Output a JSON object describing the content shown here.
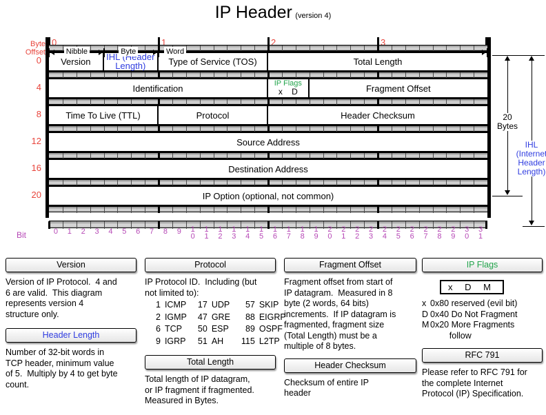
{
  "title": {
    "main": "IP Header",
    "sub": "(version 4)"
  },
  "diagram": {
    "byte_offset_label_line1": "Byte",
    "byte_offset_label_line2": "Offset",
    "bit_label": "Bit",
    "byte_offsets": [
      "0",
      "4",
      "8",
      "12",
      "16",
      "20"
    ],
    "top_ruler_numbers": [
      "0",
      "1",
      "2",
      "3"
    ],
    "bit_numbers": [
      "0",
      "1",
      "2",
      "3",
      "4",
      "5",
      "6",
      "7",
      "8",
      "9",
      "10",
      "11",
      "12",
      "13",
      "14",
      "15",
      "16",
      "17",
      "18",
      "19",
      "20",
      "21",
      "22",
      "23",
      "24",
      "25",
      "26",
      "27",
      "28",
      "29",
      "30",
      "31"
    ],
    "spans": [
      "Nibble",
      "Byte",
      "Word"
    ],
    "rows": [
      {
        "offset": "0",
        "cells": [
          {
            "label": "Version",
            "bits": 4
          },
          {
            "label": "IHL (Header Length)",
            "bits": 4,
            "color": "blue"
          },
          {
            "label": "Type of Service (TOS)",
            "bits": 8
          },
          {
            "label": "Total Length",
            "bits": 16
          }
        ]
      },
      {
        "offset": "4",
        "cells": [
          {
            "label": "Identification",
            "bits": 16
          },
          {
            "label": "IP Flags",
            "sublabel": "x  D  M",
            "bits": 3,
            "color": "green"
          },
          {
            "label": "Fragment Offset",
            "bits": 13
          }
        ]
      },
      {
        "offset": "8",
        "cells": [
          {
            "label": "Time To Live (TTL)",
            "bits": 8
          },
          {
            "label": "Protocol",
            "bits": 8
          },
          {
            "label": "Header Checksum",
            "bits": 16
          }
        ]
      },
      {
        "offset": "12",
        "cells": [
          {
            "label": "Source Address",
            "bits": 32
          }
        ]
      },
      {
        "offset": "16",
        "cells": [
          {
            "label": "Destination Address",
            "bits": 32
          }
        ]
      },
      {
        "offset": "20",
        "cells": [
          {
            "label": "IP Option (optional, not common)",
            "bits": 32
          }
        ]
      }
    ],
    "brackets": {
      "bytes_label_line1": "20",
      "bytes_label_line2": "Bytes",
      "ihl_label_line1": "IHL",
      "ihl_label_line2": "(Internet",
      "ihl_label_line3": "Header",
      "ihl_label_line4": "Length)"
    }
  },
  "legend": {
    "version": {
      "title": "Version",
      "body": "Version of IP Protocol.  4 and\n6 are valid.  This diagram\nrepresents version 4\nstructure only."
    },
    "header_length": {
      "title": "Header Length",
      "body": "Number of 32-bit words in\nTCP header, minimum value\nof 5.  Multiply by 4 to get byte\ncount."
    },
    "protocol": {
      "title": "Protocol",
      "body": "IP Protocol ID.  Including (but\nnot limited to):",
      "entries": [
        {
          "n1": "1",
          "p1": "ICMP",
          "n2": "17",
          "p2": "UDP",
          "n3": "57",
          "p3": "SKIP"
        },
        {
          "n1": "2",
          "p1": "IGMP",
          "n2": "47",
          "p2": "GRE",
          "n3": "88",
          "p3": "EIGRP"
        },
        {
          "n1": "6",
          "p1": "TCP",
          "n2": "50",
          "p2": "ESP",
          "n3": "89",
          "p3": "OSPF"
        },
        {
          "n1": "9",
          "p1": "IGRP",
          "n2": "51",
          "p2": "AH",
          "n3": "115",
          "p3": "L2TP"
        }
      ]
    },
    "total_length": {
      "title": "Total Length",
      "body": "Total length of IP datagram,\nor IP fragment if fragmented.\nMeasured in Bytes."
    },
    "fragment_offset": {
      "title": "Fragment Offset",
      "body": "Fragment offset from start of\nIP datagram.  Measured in 8\nbyte (2 words, 64 bits)\nincrements.  If IP datagram is\nfragmented, fragment size\n(Total Length) must be a\nmultiple of 8 bytes."
    },
    "header_checksum": {
      "title": "Header Checksum",
      "body": "Checksum of entire IP\nheader"
    },
    "ip_flags": {
      "title": "IP Flags",
      "box": "x  D  M",
      "defs": [
        {
          "key": "x",
          "text": "0x80 reserved (evil bit)"
        },
        {
          "key": "D",
          "text": "0x40 Do Not Fragment"
        },
        {
          "key": "M",
          "text": "0x20 More Fragments"
        },
        {
          "key": "",
          "text": "        follow"
        }
      ]
    },
    "rfc": {
      "title": "RFC 791",
      "body": "Please refer to RFC 791 for\nthe complete Internet\nProtocol (IP) Specification."
    }
  },
  "colors": {
    "offset_red": "#e8453c",
    "bit_magenta": "#b648b6",
    "accent_blue": "#2f3ce0",
    "accent_green": "#21a34a"
  }
}
